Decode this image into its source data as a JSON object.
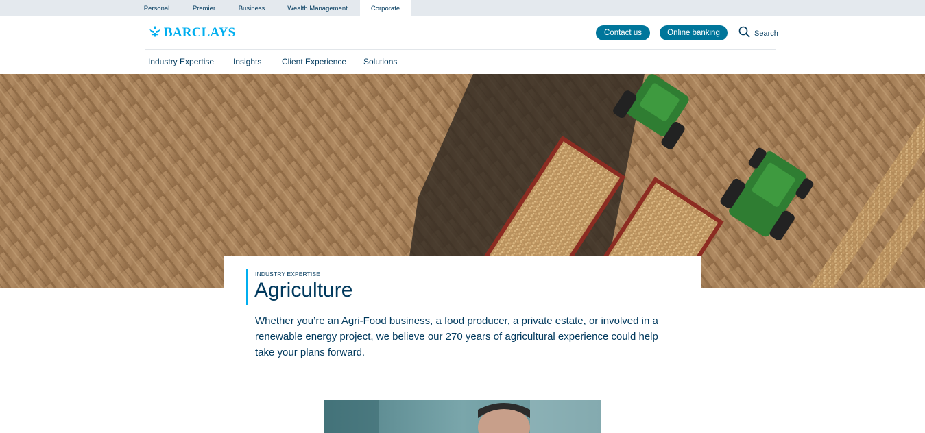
{
  "segments": [
    {
      "label": "Personal",
      "active": false
    },
    {
      "label": "Premier",
      "active": false
    },
    {
      "label": "Business",
      "active": false
    },
    {
      "label": "Wealth Management",
      "active": false
    },
    {
      "label": "Corporate",
      "active": true
    }
  ],
  "header": {
    "brand": "BARCLAYS",
    "contact_label": "Contact us",
    "online_banking_label": "Online banking",
    "search_label": "Search"
  },
  "nav": {
    "items": [
      "Industry Expertise",
      "Insights",
      "Client Experience",
      "Solutions"
    ]
  },
  "hero_card": {
    "eyebrow": "INDUSTRY EXPERTISE",
    "title": "Agriculture",
    "intro": "Whether you’re an Agri-Food business, a food producer, a private estate, or involved in a renewable energy project, we believe our 270 years of agricultural experience could help take your plans forward."
  },
  "colors": {
    "brand_blue": "#00aeef",
    "button_teal": "#00769b",
    "navy_text": "#00395d",
    "segment_bar": "#e4e9ee"
  },
  "icons": {
    "logo": "eagle-icon",
    "search": "search-icon"
  }
}
